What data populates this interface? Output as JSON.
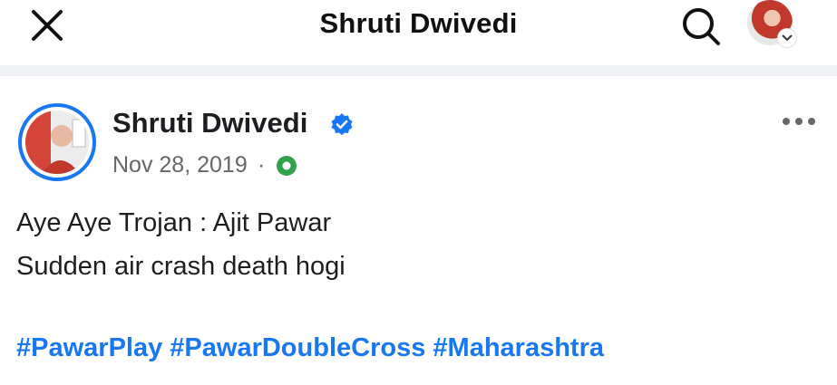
{
  "header": {
    "title": "Shruti Dwivedi",
    "close_icon": "close-icon",
    "search_icon": "search-icon",
    "profile_icon": "avatar-with-chevron"
  },
  "post": {
    "author": "Shruti Dwivedi",
    "verified": true,
    "date": "Nov 28, 2019",
    "separator": "·",
    "privacy_icon": "globe-icon",
    "lines": [
      "Aye Aye Trojan : Ajit Pawar",
      "Sudden air crash death hogi"
    ],
    "hashtags": [
      "#PawarPlay",
      "#PawarDoubleCross",
      "#Maharashtra"
    ]
  },
  "colors": {
    "accent": "#1877f2",
    "muted_text": "#65676b",
    "privacy_green": "#31a24c"
  }
}
